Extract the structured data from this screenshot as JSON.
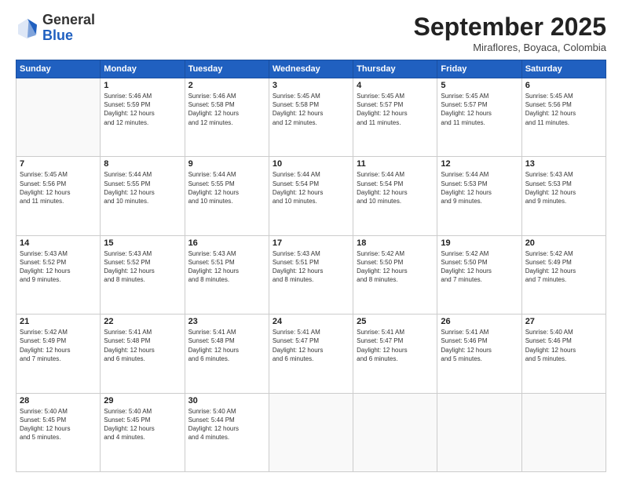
{
  "header": {
    "logo_general": "General",
    "logo_blue": "Blue",
    "month_title": "September 2025",
    "location": "Miraflores, Boyaca, Colombia"
  },
  "days_of_week": [
    "Sunday",
    "Monday",
    "Tuesday",
    "Wednesday",
    "Thursday",
    "Friday",
    "Saturday"
  ],
  "weeks": [
    [
      {
        "num": "",
        "info": ""
      },
      {
        "num": "1",
        "info": "Sunrise: 5:46 AM\nSunset: 5:59 PM\nDaylight: 12 hours\nand 12 minutes."
      },
      {
        "num": "2",
        "info": "Sunrise: 5:46 AM\nSunset: 5:58 PM\nDaylight: 12 hours\nand 12 minutes."
      },
      {
        "num": "3",
        "info": "Sunrise: 5:45 AM\nSunset: 5:58 PM\nDaylight: 12 hours\nand 12 minutes."
      },
      {
        "num": "4",
        "info": "Sunrise: 5:45 AM\nSunset: 5:57 PM\nDaylight: 12 hours\nand 11 minutes."
      },
      {
        "num": "5",
        "info": "Sunrise: 5:45 AM\nSunset: 5:57 PM\nDaylight: 12 hours\nand 11 minutes."
      },
      {
        "num": "6",
        "info": "Sunrise: 5:45 AM\nSunset: 5:56 PM\nDaylight: 12 hours\nand 11 minutes."
      }
    ],
    [
      {
        "num": "7",
        "info": "Sunrise: 5:45 AM\nSunset: 5:56 PM\nDaylight: 12 hours\nand 11 minutes."
      },
      {
        "num": "8",
        "info": "Sunrise: 5:44 AM\nSunset: 5:55 PM\nDaylight: 12 hours\nand 10 minutes."
      },
      {
        "num": "9",
        "info": "Sunrise: 5:44 AM\nSunset: 5:55 PM\nDaylight: 12 hours\nand 10 minutes."
      },
      {
        "num": "10",
        "info": "Sunrise: 5:44 AM\nSunset: 5:54 PM\nDaylight: 12 hours\nand 10 minutes."
      },
      {
        "num": "11",
        "info": "Sunrise: 5:44 AM\nSunset: 5:54 PM\nDaylight: 12 hours\nand 10 minutes."
      },
      {
        "num": "12",
        "info": "Sunrise: 5:44 AM\nSunset: 5:53 PM\nDaylight: 12 hours\nand 9 minutes."
      },
      {
        "num": "13",
        "info": "Sunrise: 5:43 AM\nSunset: 5:53 PM\nDaylight: 12 hours\nand 9 minutes."
      }
    ],
    [
      {
        "num": "14",
        "info": "Sunrise: 5:43 AM\nSunset: 5:52 PM\nDaylight: 12 hours\nand 9 minutes."
      },
      {
        "num": "15",
        "info": "Sunrise: 5:43 AM\nSunset: 5:52 PM\nDaylight: 12 hours\nand 8 minutes."
      },
      {
        "num": "16",
        "info": "Sunrise: 5:43 AM\nSunset: 5:51 PM\nDaylight: 12 hours\nand 8 minutes."
      },
      {
        "num": "17",
        "info": "Sunrise: 5:43 AM\nSunset: 5:51 PM\nDaylight: 12 hours\nand 8 minutes."
      },
      {
        "num": "18",
        "info": "Sunrise: 5:42 AM\nSunset: 5:50 PM\nDaylight: 12 hours\nand 8 minutes."
      },
      {
        "num": "19",
        "info": "Sunrise: 5:42 AM\nSunset: 5:50 PM\nDaylight: 12 hours\nand 7 minutes."
      },
      {
        "num": "20",
        "info": "Sunrise: 5:42 AM\nSunset: 5:49 PM\nDaylight: 12 hours\nand 7 minutes."
      }
    ],
    [
      {
        "num": "21",
        "info": "Sunrise: 5:42 AM\nSunset: 5:49 PM\nDaylight: 12 hours\nand 7 minutes."
      },
      {
        "num": "22",
        "info": "Sunrise: 5:41 AM\nSunset: 5:48 PM\nDaylight: 12 hours\nand 6 minutes."
      },
      {
        "num": "23",
        "info": "Sunrise: 5:41 AM\nSunset: 5:48 PM\nDaylight: 12 hours\nand 6 minutes."
      },
      {
        "num": "24",
        "info": "Sunrise: 5:41 AM\nSunset: 5:47 PM\nDaylight: 12 hours\nand 6 minutes."
      },
      {
        "num": "25",
        "info": "Sunrise: 5:41 AM\nSunset: 5:47 PM\nDaylight: 12 hours\nand 6 minutes."
      },
      {
        "num": "26",
        "info": "Sunrise: 5:41 AM\nSunset: 5:46 PM\nDaylight: 12 hours\nand 5 minutes."
      },
      {
        "num": "27",
        "info": "Sunrise: 5:40 AM\nSunset: 5:46 PM\nDaylight: 12 hours\nand 5 minutes."
      }
    ],
    [
      {
        "num": "28",
        "info": "Sunrise: 5:40 AM\nSunset: 5:45 PM\nDaylight: 12 hours\nand 5 minutes."
      },
      {
        "num": "29",
        "info": "Sunrise: 5:40 AM\nSunset: 5:45 PM\nDaylight: 12 hours\nand 4 minutes."
      },
      {
        "num": "30",
        "info": "Sunrise: 5:40 AM\nSunset: 5:44 PM\nDaylight: 12 hours\nand 4 minutes."
      },
      {
        "num": "",
        "info": ""
      },
      {
        "num": "",
        "info": ""
      },
      {
        "num": "",
        "info": ""
      },
      {
        "num": "",
        "info": ""
      }
    ]
  ]
}
